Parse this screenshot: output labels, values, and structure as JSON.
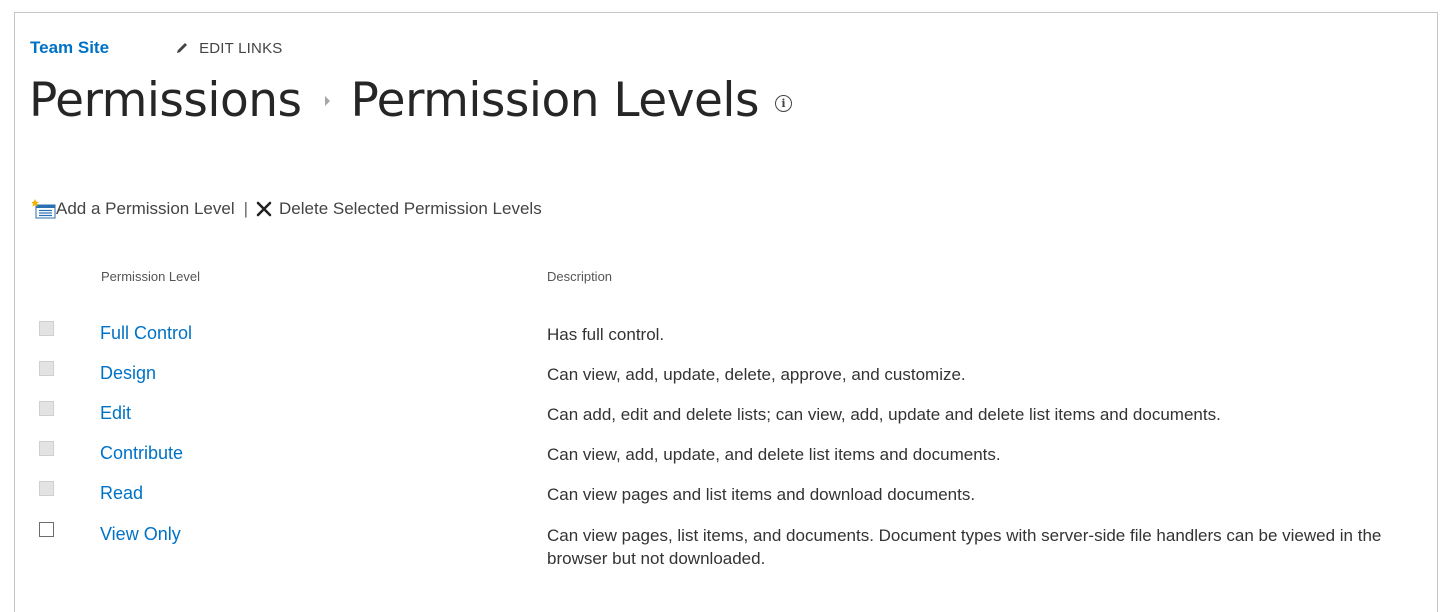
{
  "nav": {
    "site_link": "Team Site",
    "edit_links": "EDIT LINKS"
  },
  "title": {
    "parent": "Permissions",
    "current": "Permission Levels",
    "info_icon": "info-icon"
  },
  "toolbar": {
    "add_label": "Add a Permission Level",
    "separator": "|",
    "delete_label": "Delete Selected Permission Levels"
  },
  "table": {
    "headers": {
      "level": "Permission Level",
      "description": "Description"
    },
    "rows": [
      {
        "name": "Full Control",
        "description": "Has full control.",
        "checkbox_enabled": false
      },
      {
        "name": "Design",
        "description": "Can view, add, update, delete, approve, and customize.",
        "checkbox_enabled": false
      },
      {
        "name": "Edit",
        "description": "Can add, edit and delete lists; can view, add, update and delete list items and documents.",
        "checkbox_enabled": false
      },
      {
        "name": "Contribute",
        "description": "Can view, add, update, and delete list items and documents.",
        "checkbox_enabled": false
      },
      {
        "name": "Read",
        "description": "Can view pages and list items and download documents.",
        "checkbox_enabled": false
      },
      {
        "name": "View Only",
        "description": "Can view pages, list items, and documents. Document types with server-side file handlers can be viewed in the browser but not downloaded.",
        "checkbox_enabled": true
      }
    ]
  },
  "colors": {
    "link": "#0072c6",
    "text": "#333333",
    "title": "#262626"
  }
}
